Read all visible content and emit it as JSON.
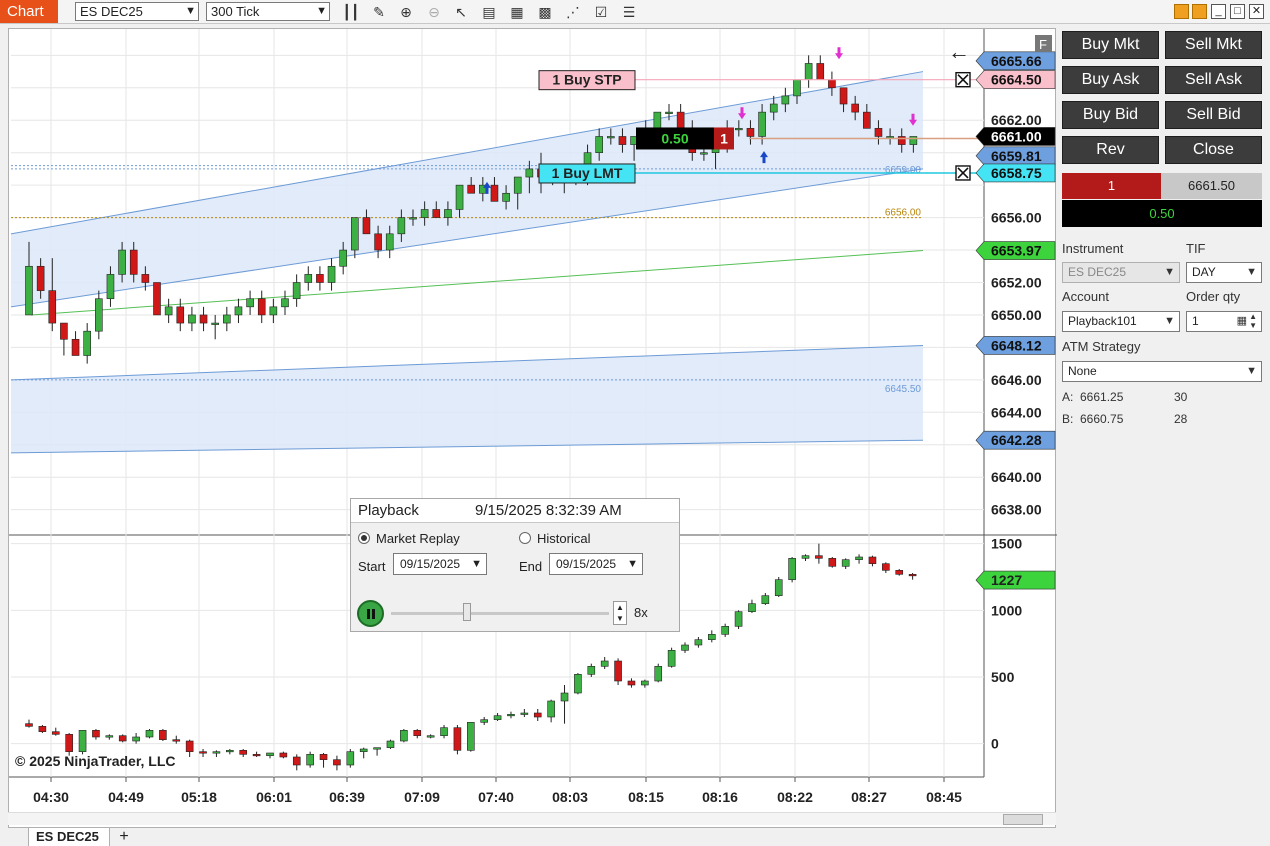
{
  "toolbar": {
    "chart_tab": "Chart",
    "instrument": "ES DEC25",
    "bar_type": "300 Tick",
    "icons": [
      "bar-type-icon",
      "drawing-tool-icon",
      "zoom-in-icon",
      "zoom-out-icon",
      "pointer-icon",
      "data-box-icon",
      "chart-properties-icon",
      "indicators-icon",
      "strategies-icon",
      "templates-icon",
      "instrument-list-icon"
    ]
  },
  "chart": {
    "price_axis_labels": [
      "6665.66",
      "6664.50",
      "6661.00",
      "6659.81",
      "6658.75",
      "6656.00",
      "6653.97",
      "6652.00",
      "6650.00",
      "6648.12",
      "6646.00",
      "6644.00",
      "6642.28",
      "6640.00",
      "6638.00"
    ],
    "band_labels": [
      "6659.00",
      "6656.00",
      "6645.50"
    ],
    "volume_axis_labels": [
      "1500",
      "1227",
      "1000",
      "500",
      "0"
    ],
    "time_labels": [
      "04:30",
      "04:49",
      "05:18",
      "06:01",
      "06:39",
      "07:09",
      "07:40",
      "08:03",
      "08:15",
      "08:16",
      "08:22",
      "08:27",
      "08:45"
    ],
    "copyright": "© 2025 NinjaTrader, LLC",
    "buy_stp_label": "1 Buy STP",
    "buy_lmt_label": "1 Buy LMT",
    "position_pnl": "0.50",
    "position_qty": "1",
    "f_marker": "F",
    "back_arrow": "←"
  },
  "playback": {
    "title": "Playback",
    "datetime": "9/15/2025 8:32:39 AM",
    "market_replay_label": "Market Replay",
    "historical_label": "Historical",
    "start_label": "Start",
    "end_label": "End",
    "start_date": "09/15/2025",
    "end_date": "09/15/2025",
    "speed": "8x"
  },
  "order_panel": {
    "buy_mkt": "Buy Mkt",
    "sell_mkt": "Sell Mkt",
    "buy_ask": "Buy Ask",
    "sell_ask": "Sell Ask",
    "buy_bid": "Buy Bid",
    "sell_bid": "Sell Bid",
    "rev": "Rev",
    "close": "Close",
    "position_qty": "1",
    "position_price": "6661.50",
    "pnl": "0.50",
    "instrument_label": "Instrument",
    "instrument_value": "ES DEC25",
    "tif_label": "TIF",
    "tif_value": "DAY",
    "account_label": "Account",
    "account_value": "Playback101",
    "order_qty_label": "Order qty",
    "order_qty_value": "1",
    "atm_label": "ATM Strategy",
    "atm_value": "None",
    "ask_label": "A:",
    "ask_price": "6661.25",
    "ask_size": "30",
    "bid_label": "B:",
    "bid_price": "6660.75",
    "bid_size": "28"
  },
  "bottom": {
    "tab": "ES DEC25",
    "add": "+"
  },
  "chart_data": {
    "type": "candlestick",
    "x_labels": [
      "04:30",
      "04:49",
      "05:18",
      "06:01",
      "06:39",
      "07:09",
      "07:40",
      "08:03",
      "08:15",
      "08:16",
      "08:22",
      "08:27",
      "08:45"
    ],
    "ylim": [
      6636.5,
      6667.5
    ],
    "price_bars": [
      [
        6650.0,
        6654.5,
        6650.0,
        6653.0
      ],
      [
        6653.0,
        6653.5,
        6651.0,
        6651.5
      ],
      [
        6651.5,
        6653.5,
        6649.0,
        6649.5
      ],
      [
        6649.5,
        6649.5,
        6647.5,
        6648.5
      ],
      [
        6648.5,
        6649.0,
        6647.5,
        6647.5
      ],
      [
        6647.5,
        6649.5,
        6647.0,
        6649.0
      ],
      [
        6649.0,
        6651.5,
        6648.5,
        6651.0
      ],
      [
        6651.0,
        6653.0,
        6650.5,
        6652.5
      ],
      [
        6652.5,
        6654.5,
        6652.0,
        6654.0
      ],
      [
        6654.0,
        6654.5,
        6652.0,
        6652.5
      ],
      [
        6652.5,
        6653.0,
        6651.5,
        6652.0
      ],
      [
        6652.0,
        6652.0,
        6650.0,
        6650.0
      ],
      [
        6650.0,
        6651.0,
        6649.5,
        6650.5
      ],
      [
        6650.5,
        6651.0,
        6649.0,
        6649.5
      ],
      [
        6649.5,
        6650.5,
        6649.0,
        6650.0
      ],
      [
        6650.0,
        6650.5,
        6649.0,
        6649.5
      ],
      [
        6649.5,
        6650.0,
        6648.5,
        6649.5
      ],
      [
        6649.5,
        6650.5,
        6649.0,
        6650.0
      ],
      [
        6650.0,
        6651.0,
        6649.5,
        6650.5
      ],
      [
        6650.5,
        6651.5,
        6650.0,
        6651.0
      ],
      [
        6651.0,
        6651.5,
        6649.5,
        6650.0
      ],
      [
        6650.0,
        6651.0,
        6649.5,
        6650.5
      ],
      [
        6650.5,
        6651.5,
        6650.0,
        6651.0
      ],
      [
        6651.0,
        6652.5,
        6650.5,
        6652.0
      ],
      [
        6652.0,
        6653.0,
        6651.5,
        6652.5
      ],
      [
        6652.5,
        6653.0,
        6651.5,
        6652.0
      ],
      [
        6652.0,
        6653.5,
        6651.5,
        6653.0
      ],
      [
        6653.0,
        6654.5,
        6652.5,
        6654.0
      ],
      [
        6654.0,
        6656.0,
        6653.5,
        6656.0
      ],
      [
        6656.0,
        6656.5,
        6655.0,
        6655.0
      ],
      [
        6655.0,
        6655.5,
        6653.5,
        6654.0
      ],
      [
        6654.0,
        6655.5,
        6653.5,
        6655.0
      ],
      [
        6655.0,
        6656.5,
        6654.5,
        6656.0
      ],
      [
        6656.0,
        6656.5,
        6655.5,
        6656.0
      ],
      [
        6656.0,
        6657.0,
        6655.5,
        6656.5
      ],
      [
        6656.5,
        6657.0,
        6656.0,
        6656.0
      ],
      [
        6656.0,
        6657.0,
        6655.5,
        6656.5
      ],
      [
        6656.5,
        6658.0,
        6656.0,
        6658.0
      ],
      [
        6658.0,
        6658.5,
        6657.5,
        6657.5
      ],
      [
        6657.5,
        6658.5,
        6657.0,
        6658.0
      ],
      [
        6658.0,
        6658.5,
        6657.0,
        6657.0
      ],
      [
        6657.0,
        6658.0,
        6656.5,
        6657.5
      ],
      [
        6657.5,
        6658.5,
        6656.5,
        6658.5
      ],
      [
        6658.5,
        6659.5,
        6657.5,
        6659.0
      ],
      [
        6659.0,
        6660.0,
        6657.5,
        6658.5
      ],
      [
        6658.5,
        6659.0,
        6658.0,
        6658.5
      ],
      [
        6658.5,
        6659.0,
        6657.5,
        6658.5
      ],
      [
        6658.5,
        6659.0,
        6658.0,
        6658.5
      ],
      [
        6658.5,
        6660.5,
        6658.0,
        6660.0
      ],
      [
        6660.0,
        6661.5,
        6659.5,
        6661.0
      ],
      [
        6661.0,
        6661.5,
        6660.5,
        6661.0
      ],
      [
        6661.0,
        6661.5,
        6660.0,
        6660.5
      ],
      [
        6660.5,
        6661.0,
        6659.5,
        6661.0
      ],
      [
        6661.0,
        6662.0,
        6660.5,
        6661.5
      ],
      [
        6661.5,
        6662.5,
        6661.0,
        6662.5
      ],
      [
        6662.5,
        6663.0,
        6662.0,
        6662.5
      ],
      [
        6662.5,
        6663.0,
        6661.5,
        6661.5
      ],
      [
        6661.5,
        6662.0,
        6659.5,
        6660.0
      ],
      [
        6660.0,
        6660.5,
        6659.5,
        6660.0
      ],
      [
        6660.0,
        6660.5,
        6659.0,
        6660.5
      ],
      [
        6660.5,
        6662.0,
        6660.0,
        6661.5
      ],
      [
        6661.5,
        6662.0,
        6661.0,
        6661.5
      ],
      [
        6661.5,
        6662.0,
        6660.5,
        6661.0
      ],
      [
        6661.0,
        6663.0,
        6660.5,
        6662.5
      ],
      [
        6662.5,
        6663.5,
        6662.0,
        6663.0
      ],
      [
        6663.0,
        6664.0,
        6662.5,
        6663.5
      ],
      [
        6663.5,
        6664.5,
        6663.0,
        6664.5
      ],
      [
        6664.5,
        6666.0,
        6664.0,
        6665.5
      ],
      [
        6665.5,
        6666.0,
        6664.5,
        6664.5
      ],
      [
        6664.5,
        6665.0,
        6663.5,
        6664.0
      ],
      [
        6664.0,
        6664.0,
        6662.5,
        6663.0
      ],
      [
        6663.0,
        6663.5,
        6662.0,
        6662.5
      ],
      [
        6662.5,
        6663.0,
        6661.5,
        6661.5
      ],
      [
        6661.5,
        6662.0,
        6660.5,
        6661.0
      ],
      [
        6661.0,
        6661.5,
        6660.5,
        6661.0
      ],
      [
        6661.0,
        6661.5,
        6660.0,
        6660.5
      ],
      [
        6660.5,
        6661.0,
        6660.0,
        6661.0
      ]
    ],
    "volume_ylim": [
      -250,
      1550
    ],
    "volume_bars": [
      [
        150,
        180,
        120,
        130
      ],
      [
        130,
        140,
        80,
        90
      ],
      [
        90,
        120,
        60,
        70
      ],
      [
        70,
        80,
        -90,
        -60
      ],
      [
        -60,
        60,
        -80,
        100
      ],
      [
        100,
        110,
        30,
        50
      ],
      [
        50,
        70,
        30,
        60
      ],
      [
        60,
        70,
        10,
        20
      ],
      [
        20,
        80,
        0,
        50
      ],
      [
        50,
        110,
        40,
        100
      ],
      [
        100,
        110,
        20,
        30
      ],
      [
        30,
        60,
        0,
        20
      ],
      [
        20,
        30,
        -100,
        -60
      ],
      [
        -60,
        -40,
        -100,
        -70
      ],
      [
        -70,
        -50,
        -100,
        -60
      ],
      [
        -60,
        -40,
        -80,
        -50
      ],
      [
        -50,
        -40,
        -100,
        -80
      ],
      [
        -80,
        -60,
        -100,
        -90
      ],
      [
        -90,
        -70,
        -110,
        -70
      ],
      [
        -70,
        -60,
        -110,
        -100
      ],
      [
        -100,
        -80,
        -200,
        -160
      ],
      [
        -160,
        -60,
        -180,
        -80
      ],
      [
        -80,
        -70,
        -180,
        -120
      ],
      [
        -120,
        -90,
        -200,
        -160
      ],
      [
        -160,
        -40,
        -180,
        -60
      ],
      [
        -60,
        -30,
        -110,
        -40
      ],
      [
        -40,
        -30,
        -90,
        -30
      ],
      [
        -30,
        30,
        -40,
        20
      ],
      [
        20,
        110,
        10,
        100
      ],
      [
        100,
        110,
        40,
        60
      ],
      [
        60,
        70,
        40,
        60
      ],
      [
        60,
        140,
        40,
        120
      ],
      [
        120,
        140,
        -80,
        -50
      ],
      [
        -50,
        150,
        -60,
        160
      ],
      [
        160,
        200,
        140,
        180
      ],
      [
        180,
        230,
        170,
        210
      ],
      [
        210,
        240,
        190,
        220
      ],
      [
        220,
        260,
        200,
        230
      ],
      [
        230,
        260,
        170,
        200
      ],
      [
        200,
        330,
        160,
        320
      ],
      [
        320,
        440,
        150,
        380
      ],
      [
        380,
        530,
        370,
        520
      ],
      [
        520,
        600,
        500,
        580
      ],
      [
        580,
        650,
        560,
        620
      ],
      [
        620,
        640,
        440,
        470
      ],
      [
        470,
        490,
        420,
        440
      ],
      [
        440,
        480,
        420,
        470
      ],
      [
        470,
        600,
        460,
        580
      ],
      [
        580,
        720,
        570,
        700
      ],
      [
        700,
        760,
        680,
        740
      ],
      [
        740,
        800,
        720,
        780
      ],
      [
        780,
        850,
        760,
        820
      ],
      [
        820,
        900,
        800,
        880
      ],
      [
        880,
        1000,
        860,
        990
      ],
      [
        990,
        1080,
        980,
        1050
      ],
      [
        1050,
        1130,
        1040,
        1110
      ],
      [
        1110,
        1250,
        1100,
        1230
      ],
      [
        1230,
        1400,
        1210,
        1390
      ],
      [
        1390,
        1420,
        1370,
        1410
      ],
      [
        1410,
        1500,
        1350,
        1390
      ],
      [
        1390,
        1400,
        1320,
        1330
      ],
      [
        1330,
        1390,
        1310,
        1380
      ],
      [
        1380,
        1420,
        1350,
        1400
      ],
      [
        1400,
        1410,
        1330,
        1350
      ],
      [
        1350,
        1360,
        1280,
        1300
      ],
      [
        1300,
        1310,
        1260,
        1270
      ],
      [
        1270,
        1280,
        1230,
        1260
      ]
    ],
    "upper_band": [
      6657.5,
      6665.0
    ],
    "upper_band_lower": [
      6655.0,
      6659.0
    ],
    "lower_band_upper": [
      6646.0,
      6648.12
    ],
    "lower_band_lower": [
      6641.5,
      6642.28
    ],
    "ma_green": [
      6650.0,
      6653.97
    ],
    "buy_stp": 6664.5,
    "buy_lmt": 6658.75,
    "position_line": 6661.0
  }
}
